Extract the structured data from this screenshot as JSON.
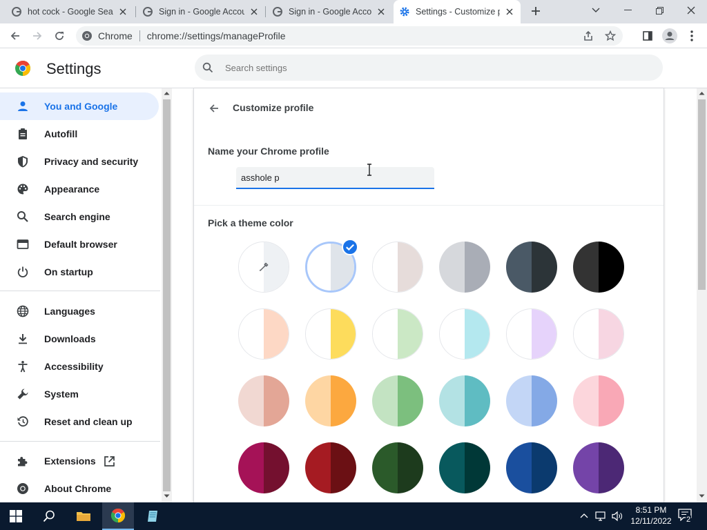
{
  "tabs": [
    {
      "title": "hot cock - Google Sear",
      "favicon": "google-g-icon",
      "active": false
    },
    {
      "title": "Sign in - Google Accou",
      "favicon": "google-g-icon",
      "active": false
    },
    {
      "title": "Sign in - Google Accou",
      "favicon": "google-g-icon",
      "active": false
    },
    {
      "title": "Settings - Customize p",
      "favicon": "gear-icon",
      "active": true
    }
  ],
  "toolbar": {
    "site_label": "Chrome",
    "url": "chrome://settings/manageProfile"
  },
  "header": {
    "title": "Settings",
    "search_placeholder": "Search settings"
  },
  "sidebar": {
    "items": [
      {
        "label": "You and Google",
        "icon": "person-icon",
        "active": true
      },
      {
        "label": "Autofill",
        "icon": "clipboard-icon"
      },
      {
        "label": "Privacy and security",
        "icon": "shield-icon"
      },
      {
        "label": "Appearance",
        "icon": "palette-icon"
      },
      {
        "label": "Search engine",
        "icon": "search-icon"
      },
      {
        "label": "Default browser",
        "icon": "browser-icon"
      },
      {
        "label": "On startup",
        "icon": "power-icon"
      },
      {
        "label": "Languages",
        "icon": "globe-icon"
      },
      {
        "label": "Downloads",
        "icon": "download-icon"
      },
      {
        "label": "Accessibility",
        "icon": "accessibility-icon"
      },
      {
        "label": "System",
        "icon": "wrench-icon"
      },
      {
        "label": "Reset and clean up",
        "icon": "reset-icon"
      },
      {
        "label": "Extensions",
        "icon": "puzzle-icon"
      },
      {
        "label": "About Chrome",
        "icon": "chrome-icon"
      }
    ]
  },
  "customize": {
    "title": "Customize profile",
    "name_label": "Name your Chrome profile",
    "name_value": "asshole p",
    "theme_label": "Pick a theme color"
  },
  "theme_colors": [
    [
      "#ffffff",
      "#eef1f4"
    ],
    [
      "#ffffff",
      "#dfe4ea"
    ],
    [
      "#ffffff",
      "#e6dcda"
    ],
    [
      "#d6d8dc",
      "#a9adb6"
    ],
    [
      "#4a5966",
      "#2c3438"
    ],
    [
      "#333333",
      "#000000"
    ],
    [
      "#ffffff",
      "#fdd8c5"
    ],
    [
      "#ffffff",
      "#fddc5c"
    ],
    [
      "#ffffff",
      "#cbe8c5"
    ],
    [
      "#ffffff",
      "#b4e8ef"
    ],
    [
      "#ffffff",
      "#e6d3fb"
    ],
    [
      "#ffffff",
      "#f7d6e2"
    ],
    [
      "#f1d8d2",
      "#e3a696"
    ],
    [
      "#fed6a3",
      "#fca83f"
    ],
    [
      "#c3e3c2",
      "#7cbf7e"
    ],
    [
      "#b3e2e4",
      "#5fbcc2"
    ],
    [
      "#c3d6f6",
      "#84a9e6"
    ],
    [
      "#fcd6dc",
      "#f9a8b6"
    ],
    [
      "#a51257",
      "#74102f"
    ],
    [
      "#a51b22",
      "#6b1014"
    ],
    [
      "#2b5a2a",
      "#1d3b1d"
    ],
    [
      "#08595d",
      "#003837"
    ],
    [
      "#1a4f9e",
      "#0b3a6e"
    ],
    [
      "#7444a8",
      "#4c2875"
    ]
  ],
  "taskbar": {
    "time": "8:51 PM",
    "date": "12/11/2022",
    "notification_count": "2"
  },
  "colors": {
    "accent": "#1a73e8",
    "active_nav_bg": "#e8f0fe",
    "titlebar": "#dee1e6",
    "taskbar": "#0a1a2f"
  }
}
